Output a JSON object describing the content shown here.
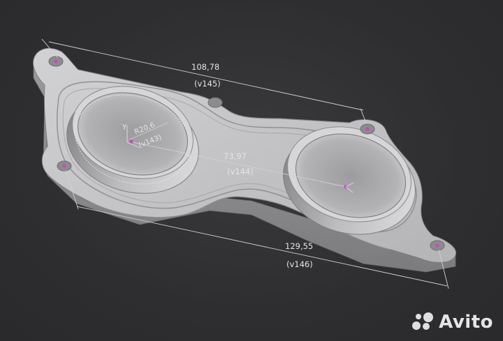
{
  "dimensions": {
    "top": {
      "value": "108,78",
      "ref": "(v145)"
    },
    "middle": {
      "value": "73,97",
      "ref": "(v144)"
    },
    "bottom": {
      "value": "129,55",
      "ref": "(v146)"
    },
    "radius": {
      "value": "R20,6",
      "ref": "(v143)"
    }
  },
  "axis": {
    "y_label": "Y"
  },
  "watermark": {
    "text": "Avito"
  },
  "colors": {
    "part": "#c9c9cb",
    "part_shadow": "#8e8e90",
    "dim_line": "#d0d0d0",
    "marker": "#d043d0",
    "background": "#2f2f31"
  }
}
